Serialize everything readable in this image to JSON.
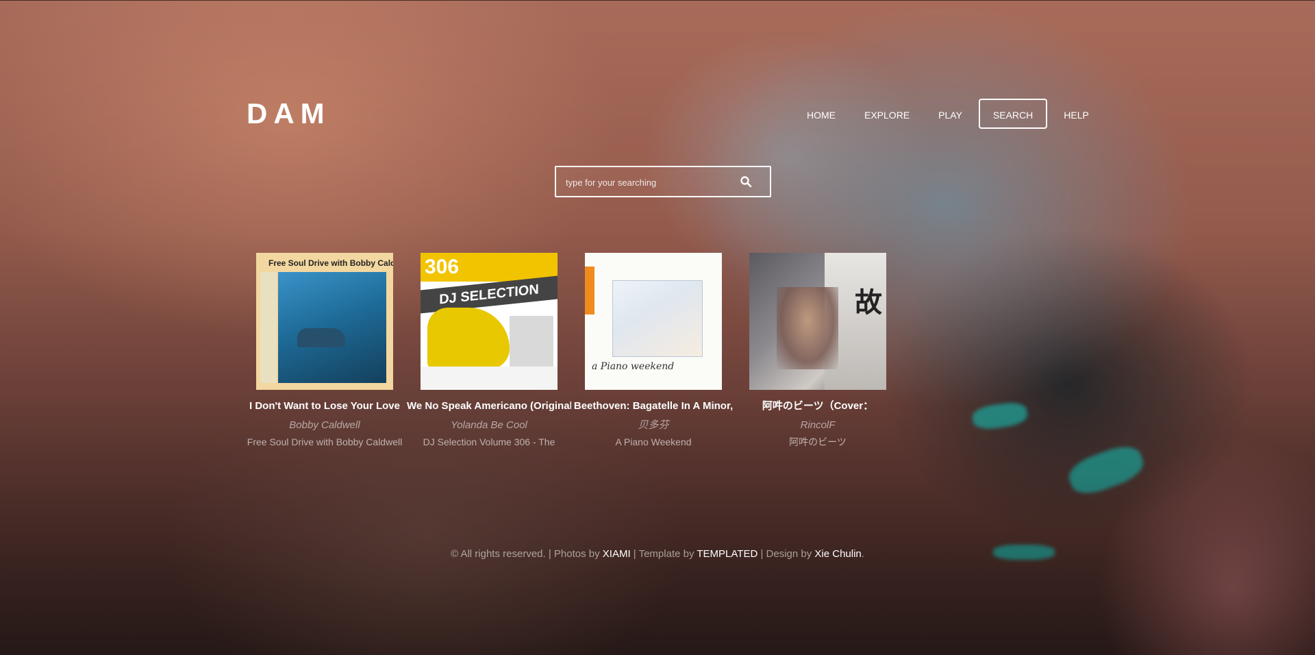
{
  "brand": {
    "logo": "DAM"
  },
  "nav": {
    "items": [
      {
        "label": "HOME",
        "active": false
      },
      {
        "label": "EXPLORE",
        "active": false
      },
      {
        "label": "PLAY",
        "active": false
      },
      {
        "label": "SEARCH",
        "active": true
      },
      {
        "label": "HELP",
        "active": false
      }
    ]
  },
  "search": {
    "value": "",
    "placeholder": "type for your searching",
    "icon": "search-icon"
  },
  "albums": [
    {
      "title": "I Don't Want to Lose Your Love",
      "artist": "Bobby Caldwell",
      "album": "Free Soul Drive with Bobby Caldwell",
      "cover_text": "Free Soul  Drive with Bobby Caldwell"
    },
    {
      "title": "We No Speak Americano (Original",
      "artist": "Yolanda Be Cool",
      "album": "DJ Selection Volume 306 - The",
      "cover_text": "306",
      "cover_label": "DJ SELECTION"
    },
    {
      "title": "Beethoven: Bagatelle In A Minor,",
      "artist": "贝多芬",
      "album": "A Piano Weekend",
      "cover_text": "a Piano weekend"
    },
    {
      "title": "阿吽のビーツ（Cover：",
      "artist": "RincolF",
      "album": "阿吽のビーツ",
      "cover_text": "故"
    }
  ],
  "footer": {
    "prefix": "© All rights reserved. | Photos by",
    "photos_link": "XIAMI",
    "template_text": "| Template by",
    "template_link": "TEMPLATED",
    "design_text": "| Design by",
    "design_link": "Xie Chulin",
    "suffix": "."
  },
  "colors": {
    "text": "#ffffff",
    "muted": "#c9b6b0",
    "accent_teal": "#1fb8ad"
  }
}
